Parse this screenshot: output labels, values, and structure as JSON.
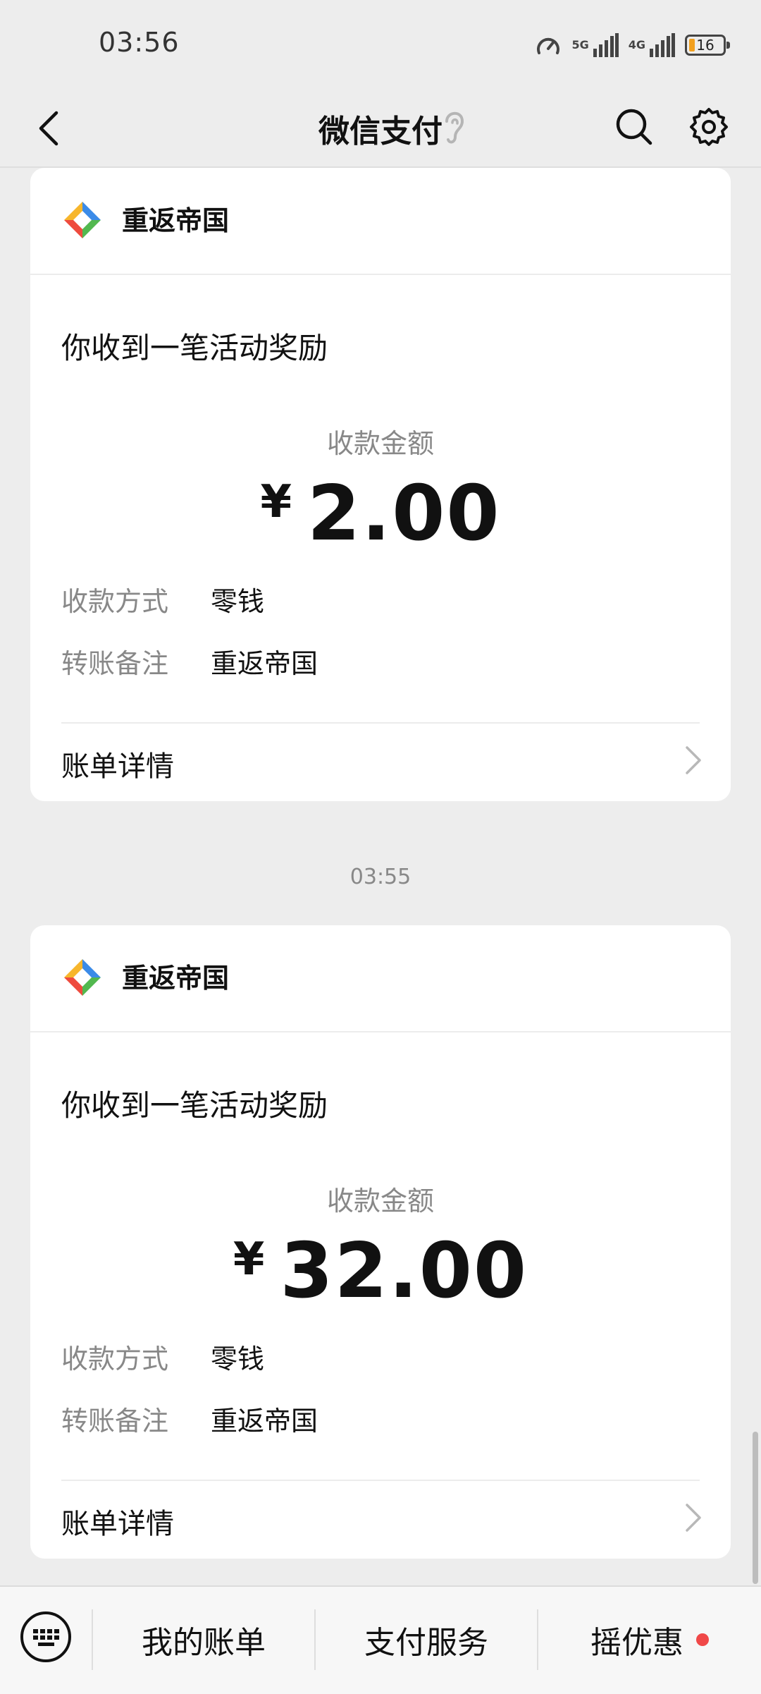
{
  "status_bar": {
    "time": "03:56",
    "network_5g": "5G",
    "network_4g": "4G",
    "battery": "16"
  },
  "header": {
    "title": "微信支付",
    "icons": [
      "back-arrow-icon",
      "ear-icon",
      "search-icon",
      "gear-icon"
    ]
  },
  "messages": [
    {
      "merchant": "重返帝国",
      "title": "你收到一笔活动奖励",
      "amount_label": "收款金额",
      "currency": "¥",
      "amount": "2.00",
      "rows": [
        {
          "label": "收款方式",
          "value": "零钱"
        },
        {
          "label": "转账备注",
          "value": "重返帝国"
        }
      ],
      "detail_label": "账单详情"
    },
    {
      "timestamp": "03:55",
      "merchant": "重返帝国",
      "title": "你收到一笔活动奖励",
      "amount_label": "收款金额",
      "currency": "¥",
      "amount": "32.00",
      "rows": [
        {
          "label": "收款方式",
          "value": "零钱"
        },
        {
          "label": "转账备注",
          "value": "重返帝国"
        }
      ],
      "detail_label": "账单详情"
    }
  ],
  "bottom_bar": {
    "tabs": [
      {
        "label": "我的账单"
      },
      {
        "label": "支付服务"
      },
      {
        "label": "摇优惠"
      }
    ]
  },
  "colors": {
    "background": "#ededed",
    "card": "#ffffff",
    "badge_red": "#f04848"
  }
}
